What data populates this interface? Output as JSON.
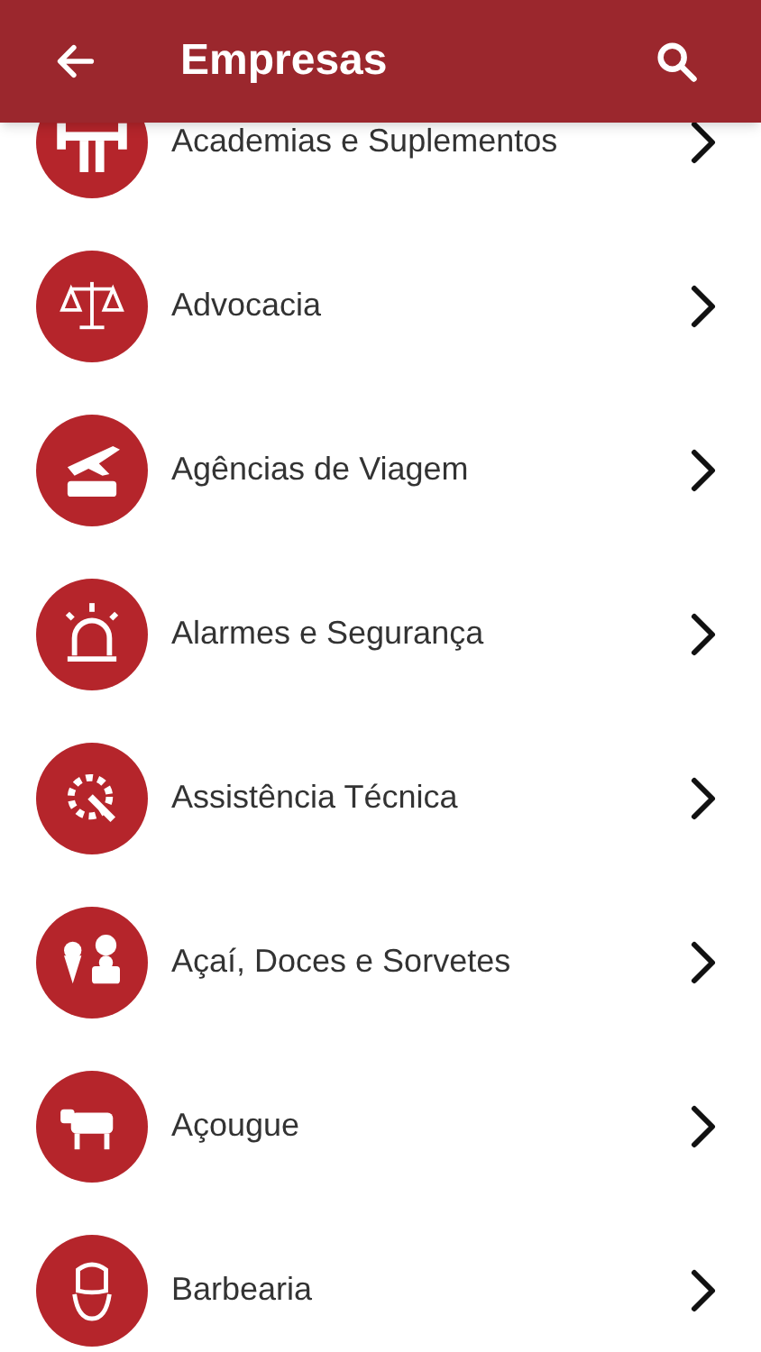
{
  "header": {
    "title": "Empresas"
  },
  "categories": [
    {
      "label": "Academias e Suplementos"
    },
    {
      "label": "Advocacia"
    },
    {
      "label": "Agências de Viagem"
    },
    {
      "label": "Alarmes e Segurança"
    },
    {
      "label": "Assistência Técnica"
    },
    {
      "label": "Açaí, Doces e Sorvetes"
    },
    {
      "label": "Açougue"
    },
    {
      "label": "Barbearia"
    }
  ]
}
